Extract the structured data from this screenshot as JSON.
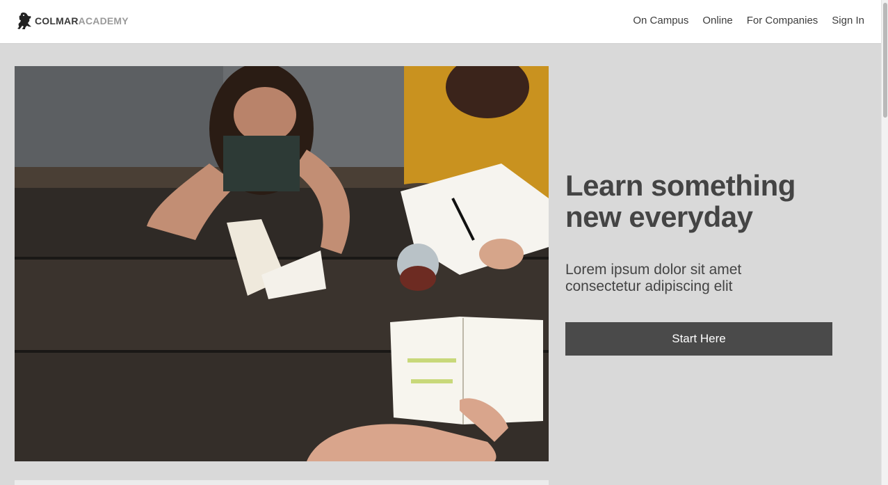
{
  "brand": {
    "name_part1": "COLMAR",
    "name_part2": "ACADEMY",
    "logo_icon": "lion-rampant-icon",
    "dark_color": "#3a3a3a",
    "light_color": "#9a9a9a"
  },
  "nav": {
    "items": [
      {
        "label": "On Campus"
      },
      {
        "label": "Online"
      },
      {
        "label": "For Companies"
      },
      {
        "label": "Sign In"
      }
    ]
  },
  "hero": {
    "title_line1": "Learn something",
    "title_line2": "new everyday",
    "subtitle_line1": "Lorem ipsum dolor sit amet",
    "subtitle_line2": "consectetur adipiscing elit",
    "cta_label": "Start Here",
    "photo_icon": "students-studying-photo"
  },
  "colors": {
    "background": "#d9d9d9",
    "header_bg": "#ffffff",
    "text": "#444444",
    "button_bg": "#4a4a4a",
    "button_text": "#ffffff"
  }
}
